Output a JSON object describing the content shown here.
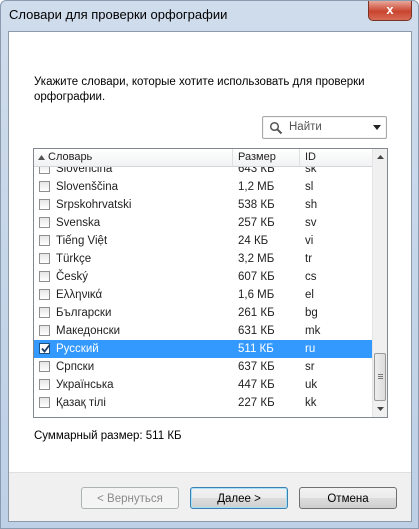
{
  "window": {
    "title": "Словари для проверки орфографии",
    "close_symbol": "x"
  },
  "instructions": "Укажите словари, которые хотите использовать для проверки орфографии.",
  "search": {
    "placeholder": "Найти"
  },
  "table": {
    "columns": {
      "name": "Словарь",
      "size": "Размер",
      "id": "ID"
    },
    "rows": [
      {
        "name": "Slovenčina",
        "size": "643 КБ",
        "id": "sk",
        "checked": false,
        "selected": false
      },
      {
        "name": "Slovenščina",
        "size": "1,2 МБ",
        "id": "sl",
        "checked": false,
        "selected": false
      },
      {
        "name": "Srpskohrvatski",
        "size": "538 КБ",
        "id": "sh",
        "checked": false,
        "selected": false
      },
      {
        "name": "Svenska",
        "size": "257 КБ",
        "id": "sv",
        "checked": false,
        "selected": false
      },
      {
        "name": "Tiếng Việt",
        "size": "24 КБ",
        "id": "vi",
        "checked": false,
        "selected": false
      },
      {
        "name": "Türkçe",
        "size": "3,2 МБ",
        "id": "tr",
        "checked": false,
        "selected": false
      },
      {
        "name": "Český",
        "size": "607 КБ",
        "id": "cs",
        "checked": false,
        "selected": false
      },
      {
        "name": "Ελληνικά",
        "size": "1,6 МБ",
        "id": "el",
        "checked": false,
        "selected": false
      },
      {
        "name": "Български",
        "size": "261 КБ",
        "id": "bg",
        "checked": false,
        "selected": false
      },
      {
        "name": "Македонски",
        "size": "631 КБ",
        "id": "mk",
        "checked": false,
        "selected": false
      },
      {
        "name": "Русский",
        "size": "511 КБ",
        "id": "ru",
        "checked": true,
        "selected": true
      },
      {
        "name": "Српски",
        "size": "637 КБ",
        "id": "sr",
        "checked": false,
        "selected": false
      },
      {
        "name": "Українська",
        "size": "447 КБ",
        "id": "uk",
        "checked": false,
        "selected": false
      },
      {
        "name": "Қазақ тілі",
        "size": "227 КБ",
        "id": "kk",
        "checked": false,
        "selected": false
      }
    ]
  },
  "total": "Суммарный размер: 511 КБ",
  "buttons": {
    "back": "< Вернуться",
    "next": "Далее >",
    "cancel": "Отмена"
  },
  "colors": {
    "selection": "#3399ff",
    "close_button": "#c9442e"
  },
  "icons": {
    "search": "search-icon",
    "dropdown": "chevron-down-icon",
    "sort": "sort-up-icon",
    "check": "check-icon"
  }
}
